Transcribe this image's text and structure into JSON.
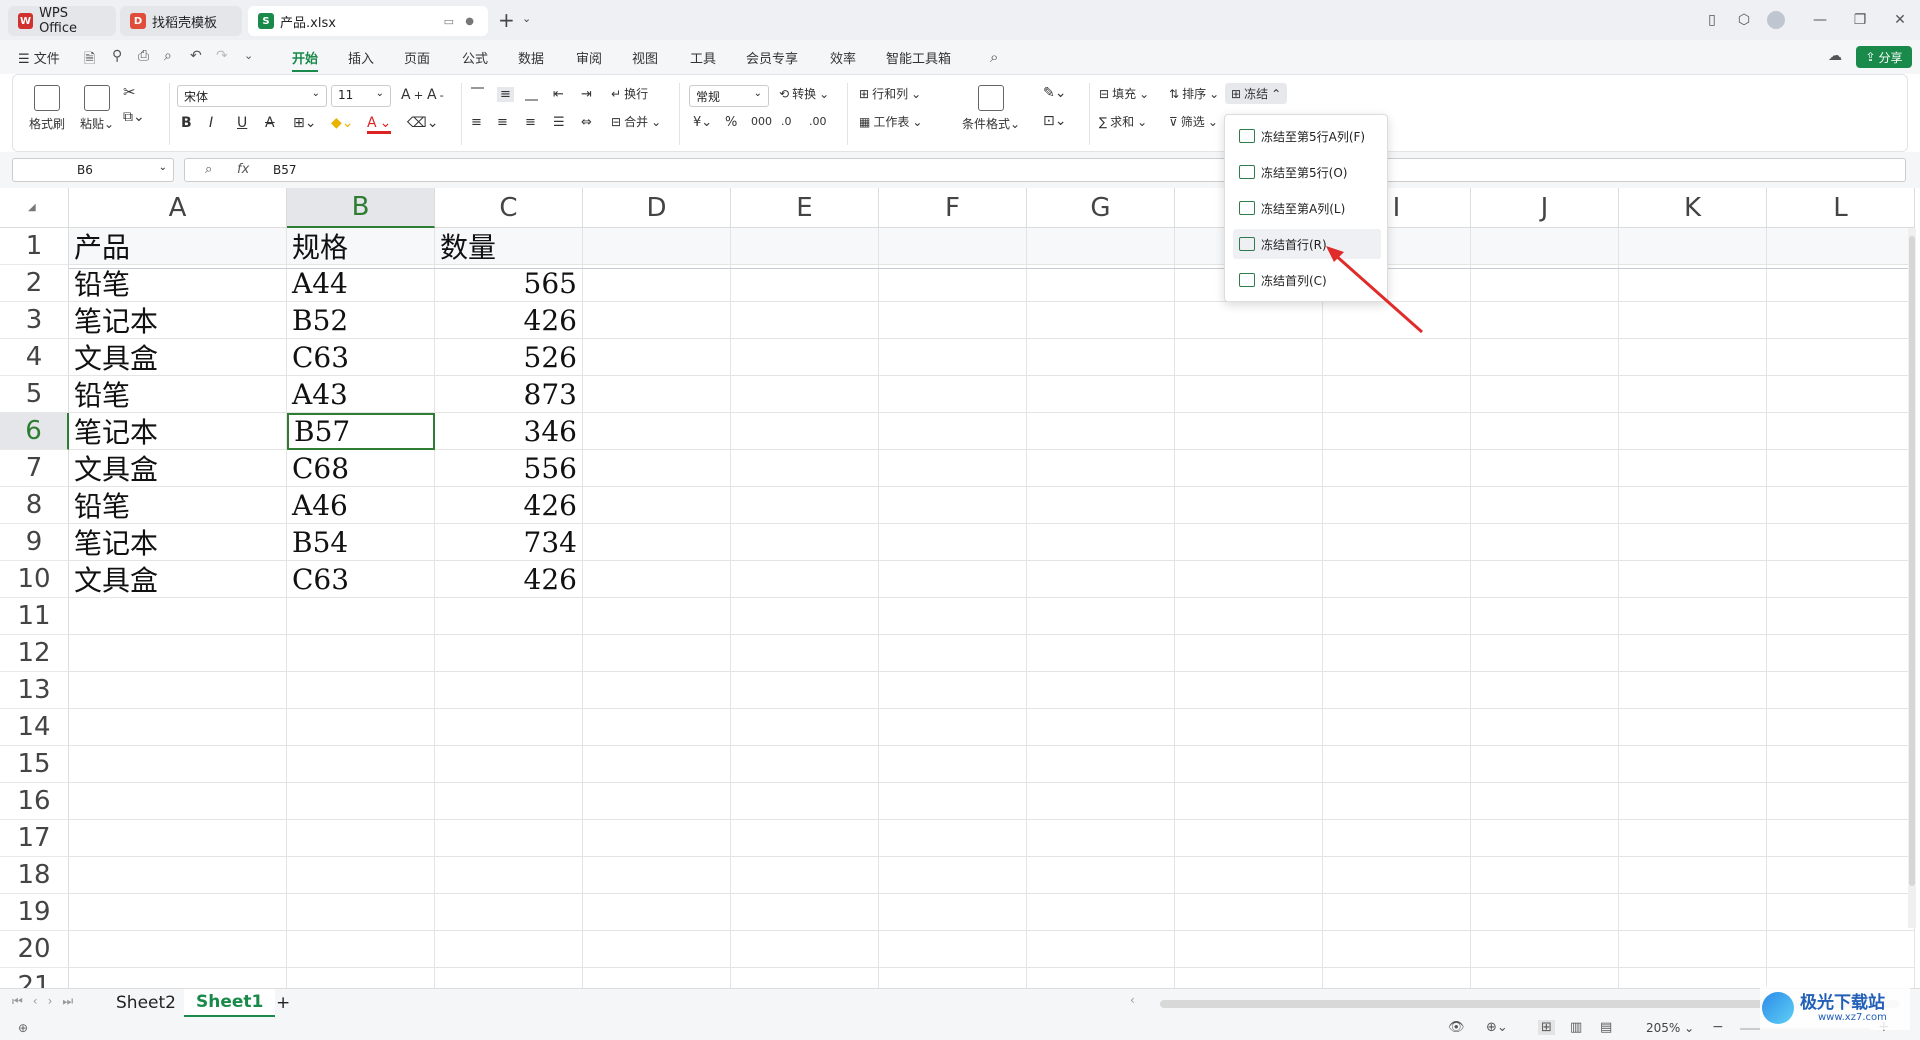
{
  "titlebar": {
    "tabs": [
      {
        "label": "WPS Office",
        "icon": "wps-logo-icon",
        "color": "#d2322d"
      },
      {
        "label": "找稻壳模板",
        "icon": "docer-icon",
        "color": "#e04d3a"
      },
      {
        "label": "产品.xlsx",
        "icon": "spreadsheet-icon",
        "color": "#1a8a4a"
      }
    ]
  },
  "menubar": {
    "file_label": "文件",
    "items": [
      "开始",
      "插入",
      "页面",
      "公式",
      "数据",
      "审阅",
      "视图",
      "工具",
      "会员专享",
      "效率",
      "智能工具箱"
    ],
    "active": "开始",
    "share_label": "分享"
  },
  "ribbon": {
    "format_painter": "格式刷",
    "paste": "粘贴",
    "font_name": "宋体",
    "font_size": "11",
    "wrap": "换行",
    "merge": "合并",
    "number_format": "常规",
    "convert": "转换",
    "rows_cols": "行和列",
    "worksheet": "工作表",
    "cond_format": "条件格式",
    "fill": "填充",
    "sum": "求和",
    "sort": "排序",
    "filter": "筛选",
    "freeze": "冻结",
    "bold": "B",
    "italic": "I",
    "underline": "U",
    "strike": "A",
    "font_color": "A"
  },
  "formula_bar": {
    "name_box": "B6",
    "fx": "fx",
    "content": "B57"
  },
  "freeze_menu": {
    "items": [
      "冻结至第5行A列(F)",
      "冻结至第5行(O)",
      "冻结至第A列(L)",
      "冻结首行(R)",
      "冻结首列(C)"
    ],
    "hovered_index": 3
  },
  "grid": {
    "columns": [
      "A",
      "B",
      "C",
      "D",
      "E",
      "F",
      "G",
      "H",
      "I",
      "J",
      "K",
      "L"
    ],
    "rows": [
      "1",
      "2",
      "3",
      "4",
      "5",
      "6",
      "7",
      "8",
      "9",
      "10",
      "11",
      "12",
      "13",
      "14",
      "15",
      "16",
      "17",
      "18",
      "19",
      "20",
      "21"
    ],
    "header_row": [
      "产品",
      "规格",
      "数量"
    ],
    "data": [
      [
        "铅笔",
        "A44",
        "565"
      ],
      [
        "笔记本",
        "B52",
        "426"
      ],
      [
        "文具盒",
        "C63",
        "526"
      ],
      [
        "铅笔",
        "A43",
        "873"
      ],
      [
        "笔记本",
        "B57",
        "346"
      ],
      [
        "文具盒",
        "C68",
        "556"
      ],
      [
        "铅笔",
        "A46",
        "426"
      ],
      [
        "笔记本",
        "B54",
        "734"
      ],
      [
        "文具盒",
        "C63",
        "426"
      ]
    ],
    "selected_cell": "B6",
    "accent_color": "#2e7d32"
  },
  "sheets": {
    "tabs": [
      "Sheet2",
      "Sheet1"
    ],
    "active": "Sheet1",
    "add_label": "+"
  },
  "statusbar": {
    "zoom": "205%"
  },
  "watermark": {
    "text": "极光下载站",
    "url": "www.xz7.com"
  }
}
